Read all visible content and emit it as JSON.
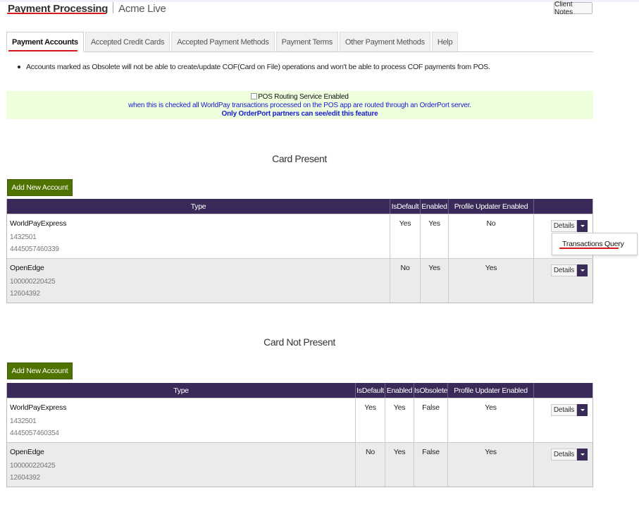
{
  "header": {
    "title": "Payment Processing",
    "subtitle": "Acme Live",
    "client_notes_label": "Client Notes"
  },
  "tabs": [
    {
      "label": "Payment Accounts",
      "active": true
    },
    {
      "label": "Accepted Credit Cards",
      "active": false
    },
    {
      "label": "Accepted Payment Methods",
      "active": false
    },
    {
      "label": "Payment Terms",
      "active": false
    },
    {
      "label": "Other Payment Methods",
      "active": false
    },
    {
      "label": "Help",
      "active": false
    }
  ],
  "note": "Accounts marked as Obsolete will not be able to create/update COF(Card on File) operations and won't be able to process COF payments from POS.",
  "pos_routing": {
    "checkbox_label": "POS Routing Service Enabled",
    "checked": false,
    "description": "when this is checked all WorldPay transactions processed on the POS app are routed through an OrderPort server.",
    "partners_note": "Only OrderPort partners can see/edit this feature"
  },
  "card_present": {
    "title": "Card Present",
    "add_button": "Add New Account",
    "columns": [
      "Type",
      "IsDefault",
      "Enabled",
      "Profile Updater Enabled",
      ""
    ],
    "rows": [
      {
        "type": "WorldPayExpress",
        "id1": "1432501",
        "id2": "4445057460339",
        "is_default": "Yes",
        "enabled": "Yes",
        "profile_updater": "No",
        "details": "Details"
      },
      {
        "type": "OpenEdge",
        "id1": "100000220425",
        "id2": "12604392",
        "is_default": "No",
        "enabled": "Yes",
        "profile_updater": "Yes",
        "details": "Details"
      }
    ]
  },
  "dropdown": {
    "item": "Transactions Query"
  },
  "card_not_present": {
    "title": "Card Not Present",
    "add_button": "Add New Account",
    "columns": [
      "Type",
      "IsDefault",
      "Enabled",
      "IsObsolete",
      "Profile Updater Enabled",
      ""
    ],
    "rows": [
      {
        "type": "WorldPayExpress",
        "id1": "1432501",
        "id2": "4445057460354",
        "is_default": "Yes",
        "enabled": "Yes",
        "is_obsolete": "False",
        "profile_updater": "Yes",
        "details": "Details"
      },
      {
        "type": "OpenEdge",
        "id1": "100000220425",
        "id2": "12604392",
        "is_default": "No",
        "enabled": "Yes",
        "is_obsolete": "False",
        "profile_updater": "Yes",
        "details": "Details"
      }
    ]
  },
  "colors": {
    "header_bg": "#3a2a59",
    "button_green": "#4f7300",
    "pos_box_bg": "#eeffdd",
    "link_blue": "#1a1ad0",
    "annotation_red": "#d7191c"
  }
}
